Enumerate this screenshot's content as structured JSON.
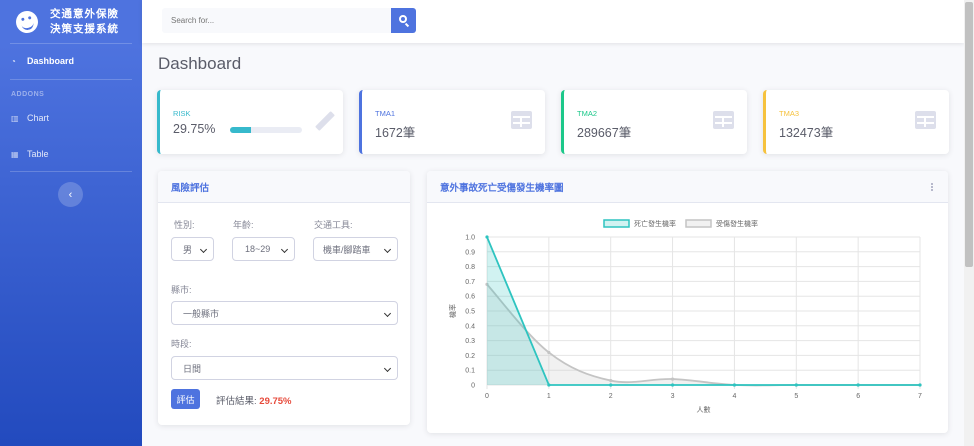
{
  "sidebar": {
    "brand_line1": "交通意外保險",
    "brand_line2": "決策支援系統",
    "dashboard": "Dashboard",
    "addons_heading": "ADDONS",
    "chart": "Chart",
    "table": "Table",
    "toggle_glyph": "‹"
  },
  "topbar": {
    "search_placeholder": "Search for..."
  },
  "page_title": "Dashboard",
  "stats": {
    "risk": {
      "label": "RISK",
      "value": "29.75%",
      "progress": 0.2975,
      "color": "#36b9cc"
    },
    "tma1": {
      "label": "TMA1",
      "value": "1672筆",
      "color": "#4e73df"
    },
    "tma2": {
      "label": "TMA2",
      "value": "289667筆",
      "color": "#1cc88a"
    },
    "tma3": {
      "label": "TMA3",
      "value": "132473筆",
      "color": "#f6c23e"
    }
  },
  "risk_form": {
    "title": "風險評估",
    "gender_label": "性別:",
    "gender_value": "男",
    "age_label": "年齡:",
    "age_value": "18~29",
    "vehicle_label": "交通工具:",
    "vehicle_value": "機車/腳踏車",
    "county_label": "縣市:",
    "county_value": "一般縣市",
    "period_label": "時段:",
    "period_value": "日間",
    "evaluate_button": "評估",
    "result_label": "評估結果:",
    "result_value": "29.75%"
  },
  "chart_card": {
    "title": "意外事故死亡受傷發生機率圖"
  },
  "chart_data": {
    "type": "area",
    "title": "",
    "xlabel": "人數",
    "ylabel": "機率",
    "x": [
      0,
      1,
      2,
      3,
      4,
      5,
      6,
      7
    ],
    "xlim": [
      0,
      7
    ],
    "ylim": [
      0,
      1.0
    ],
    "yticks": [
      0,
      0.1,
      0.2,
      0.3,
      0.4,
      0.5,
      0.6,
      0.7,
      0.8,
      0.9,
      1.0
    ],
    "legend_position": "top-center",
    "grid": true,
    "series": [
      {
        "name": "死亡發生機率",
        "values": [
          1.0,
          0,
          0,
          0,
          0,
          0,
          0,
          0
        ],
        "color": "#2ec4c0",
        "fill": "rgba(46,196,192,0.22)"
      },
      {
        "name": "受傷發生機率",
        "values": [
          0.68,
          0.22,
          0.03,
          0.04,
          0,
          0,
          0,
          0
        ],
        "color": "#c4c4c4",
        "fill": "rgba(200,200,200,0.25)"
      }
    ]
  }
}
